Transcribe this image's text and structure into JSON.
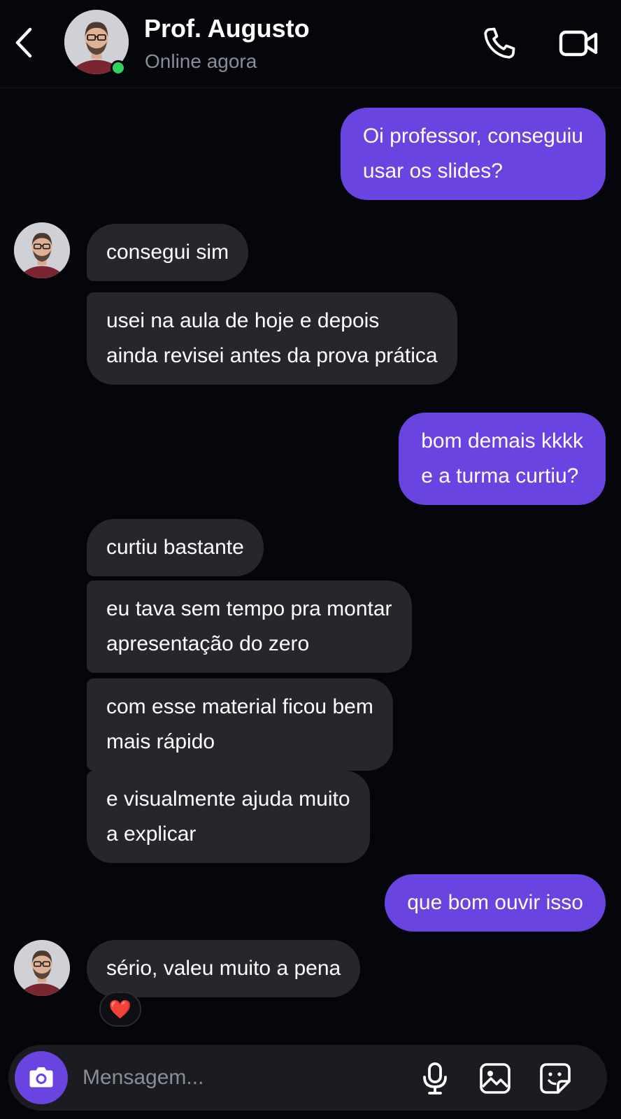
{
  "header": {
    "contact_name": "Prof. Augusto",
    "status": "Online agora",
    "icons": {
      "back": "chevron-left-icon",
      "call": "phone-icon",
      "video": "video-camera-icon"
    },
    "online_indicator_color": "#2fd25a"
  },
  "messages": [
    {
      "direction": "out",
      "lines": [
        "Oi professor, conseguiu",
        "usar os slides?"
      ]
    },
    {
      "direction": "in",
      "lines": [
        "consegui sim"
      ],
      "avatar": true
    },
    {
      "direction": "in",
      "lines": [
        "usei na aula de hoje e depois",
        "ainda revisei antes da prova prática"
      ]
    },
    {
      "direction": "out",
      "lines": [
        "bom demais kkkk",
        "e a turma curtiu?"
      ]
    },
    {
      "direction": "in",
      "lines": [
        "curtiu bastante"
      ]
    },
    {
      "direction": "in",
      "lines": [
        "eu tava sem tempo pra montar",
        "apresentação do zero"
      ]
    },
    {
      "direction": "in",
      "lines": [
        "com esse material ficou bem",
        "mais rápido"
      ]
    },
    {
      "direction": "in",
      "lines": [
        "e visualmente ajuda muito",
        "a explicar"
      ]
    },
    {
      "direction": "out",
      "lines": [
        "que bom ouvir isso"
      ]
    },
    {
      "direction": "in",
      "lines": [
        "sério, valeu muito a pena"
      ],
      "avatar": true,
      "reaction": "❤️"
    }
  ],
  "composer": {
    "placeholder": "Mensagem...",
    "icons": {
      "camera": "camera-icon",
      "mic": "microphone-icon",
      "gallery": "image-icon",
      "sticker": "sticker-icon"
    }
  },
  "colors": {
    "background": "#05060c",
    "outgoing_bubble": "#6a44e0",
    "incoming_bubble": "#26272d",
    "muted_text": "#8b8d96"
  }
}
